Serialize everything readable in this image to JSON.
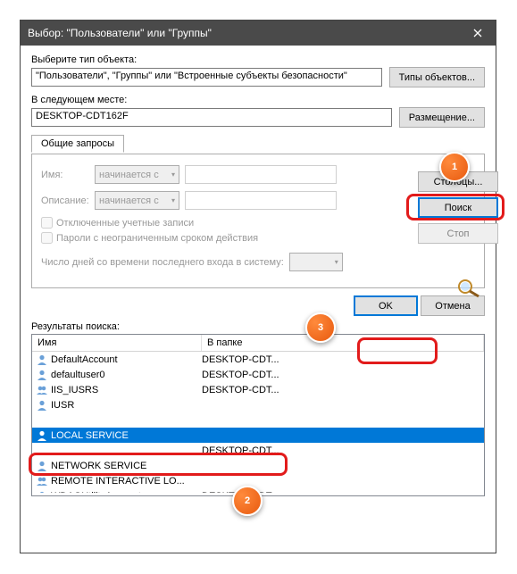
{
  "window": {
    "title": "Выбор: \"Пользователи\" или \"Группы\""
  },
  "section": {
    "objectTypeLabel": "Выберите тип объекта:",
    "objectTypeValue": "\"Пользователи\", \"Группы\" или \"Встроенные субъекты безопасности\"",
    "objectTypesBtn": "Типы объектов...",
    "locationLabel": "В следующем месте:",
    "locationValue": "DESKTOP-CDT162F",
    "locationsBtn": "Размещение..."
  },
  "tab": {
    "commonQueries": "Общие запросы"
  },
  "form": {
    "nameLabel": "Имя:",
    "descLabel": "Описание:",
    "startsWith": "начинается с",
    "disabledAccounts": "Отключенные учетные записи",
    "passwordNoExpire": "Пароли с неограниченным сроком действия",
    "daysSince": "Число дней со времени последнего входа в систему:"
  },
  "buttons": {
    "columns": "Столбцы...",
    "findNow": "Поиск",
    "stop": "Стоп",
    "ok": "OK",
    "cancel": "Отмена"
  },
  "results": {
    "label": "Результаты поиска:",
    "headerName": "Имя",
    "headerFolder": "В папке",
    "rows": [
      {
        "name": "DefaultAccount",
        "folder": "DESKTOP-CDT...",
        "icon": "user",
        "selected": false
      },
      {
        "name": "defaultuser0",
        "folder": "DESKTOP-CDT...",
        "icon": "user",
        "selected": false
      },
      {
        "name": "IIS_IUSRS",
        "folder": "DESKTOP-CDT...",
        "icon": "group",
        "selected": false
      },
      {
        "name": "IUSR",
        "folder": "",
        "icon": "user",
        "selected": false
      },
      {
        "name": "",
        "folder": "",
        "icon": "",
        "selected": false
      },
      {
        "name": "LOCAL SERVICE",
        "folder": "",
        "icon": "user",
        "selected": true
      },
      {
        "name": "",
        "folder": "DESKTOP-CDT...",
        "icon": "",
        "selected": false
      },
      {
        "name": "NETWORK SERVICE",
        "folder": "",
        "icon": "user",
        "selected": false
      },
      {
        "name": "REMOTE INTERACTIVE LO...",
        "folder": "",
        "icon": "group",
        "selected": false
      },
      {
        "name": "WDAGUtilityAccount",
        "folder": "DESKTOP-CDT...",
        "icon": "user",
        "selected": false
      }
    ]
  },
  "callouts": {
    "c1": "1",
    "c2": "2",
    "c3": "3"
  }
}
